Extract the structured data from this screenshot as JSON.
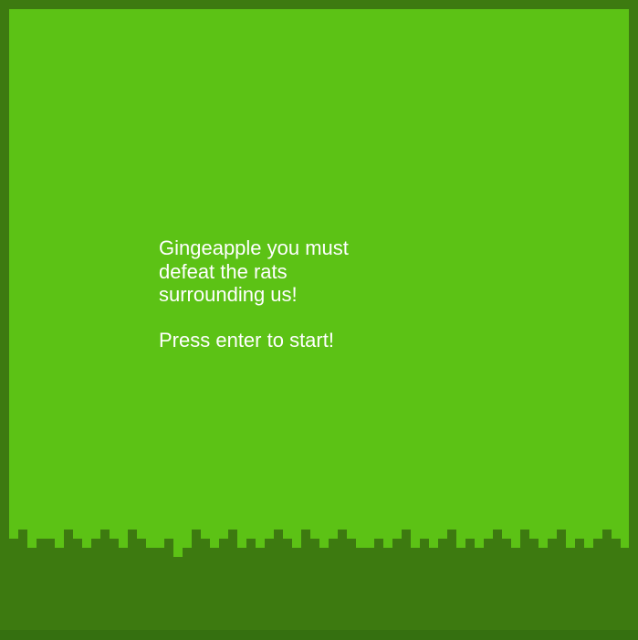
{
  "game": {
    "intro_lines": [
      "Gingeapple you must",
      "defeat the rats",
      "surrounding us!"
    ],
    "prompt": "Press enter to start!"
  },
  "colors": {
    "background_grass": "#5cc215",
    "dark_grass": "#3d7a10",
    "text": "#ffffff"
  }
}
